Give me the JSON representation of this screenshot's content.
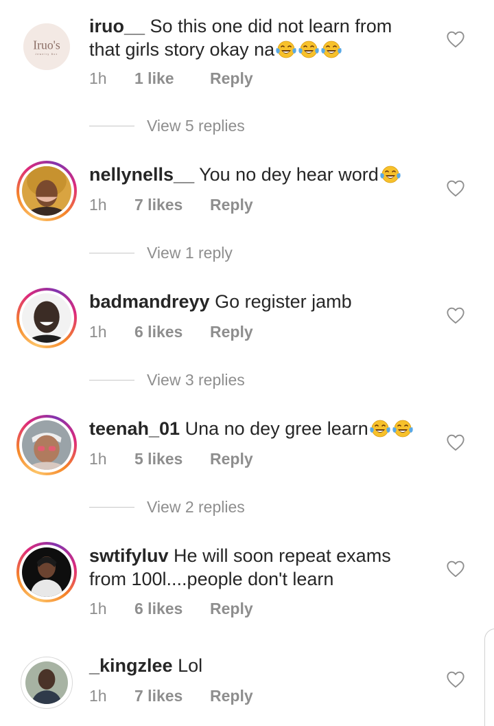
{
  "comments": [
    {
      "username": "iruo__",
      "text": "So this one did not learn from that girls story okay na",
      "emoji_count": 3,
      "time": "1h",
      "likes": "1 like",
      "reply": "Reply",
      "view_replies": "View 5 replies",
      "avatar_text": "Iruo's",
      "avatar_subtext": "Jewelry Box"
    },
    {
      "username": "nellynells__",
      "text": "You no dey hear word",
      "emoji_count": 1,
      "time": "1h",
      "likes": "7 likes",
      "reply": "Reply",
      "view_replies": "View 1 reply"
    },
    {
      "username": "badmandreyy",
      "text": "Go register jamb",
      "emoji_count": 0,
      "time": "1h",
      "likes": "6 likes",
      "reply": "Reply",
      "view_replies": "View 3 replies"
    },
    {
      "username": "teenah_01",
      "text": "Una no dey gree learn",
      "emoji_count": 2,
      "time": "1h",
      "likes": "5 likes",
      "reply": "Reply",
      "view_replies": "View 2 replies"
    },
    {
      "username": "swtifyluv",
      "text": "He will soon repeat exams from 100l....people don't learn",
      "emoji_count": 0,
      "time": "1h",
      "likes": "6 likes",
      "reply": "Reply"
    },
    {
      "username": "_kingzlee",
      "text": "Lol",
      "emoji_count": 0,
      "time": "1h",
      "likes": "7 likes",
      "reply": "Reply"
    }
  ],
  "colors": {
    "text": "#262626",
    "secondary": "#8e8e8e",
    "story_ring": [
      "#fdc468",
      "#f58529",
      "#dd2a7b",
      "#8134af"
    ],
    "emoji_yellow": "#f7c12b",
    "emoji_tear": "#5aa9e6"
  },
  "icons": {
    "like": "heart-outline-icon",
    "emoji": "face-with-tears-of-joy-emoji"
  }
}
